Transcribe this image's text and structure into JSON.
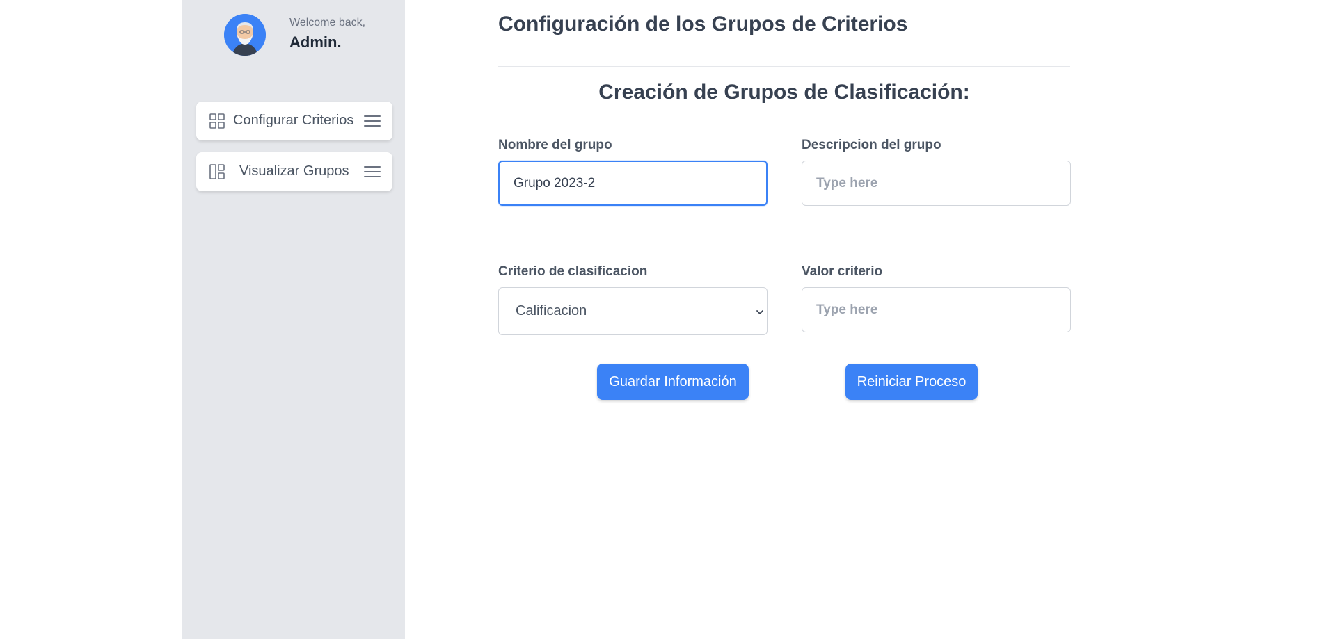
{
  "sidebar": {
    "welcome": "Welcome back,",
    "user_name": "Admin.",
    "items": [
      {
        "label": "Configurar Criterios",
        "icon": "grid-icon"
      },
      {
        "label": "Visualizar Grupos",
        "icon": "layout-icon"
      }
    ]
  },
  "main": {
    "page_title": "Configuración de los Grupos de Criterios",
    "section_title": "Creación de Grupos de Clasificación:",
    "form": {
      "group_name": {
        "label": "Nombre del grupo",
        "value": "Grupo 2023-2"
      },
      "group_description": {
        "label": "Descripcion del grupo",
        "placeholder": "Type here",
        "value": ""
      },
      "criterion": {
        "label": "Criterio de clasificacion",
        "selected": "Calificacion"
      },
      "criterion_value": {
        "label": "Valor criterio",
        "placeholder": "Type here",
        "value": ""
      }
    },
    "buttons": {
      "save": "Guardar Información",
      "reset": "Reiniciar Proceso"
    }
  },
  "colors": {
    "accent": "#3b82f6",
    "sidebar_bg": "#e5e7eb",
    "text": "#374151"
  }
}
